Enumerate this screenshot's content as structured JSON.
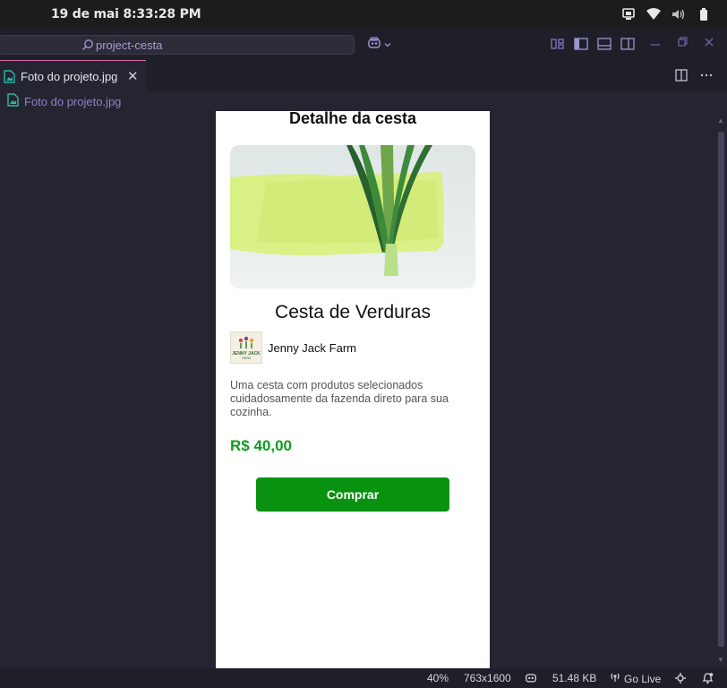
{
  "system_bar": {
    "clock": "19 de mai   8:33:28 PM",
    "icons": [
      "screen-share-icon",
      "wifi-icon",
      "volume-icon",
      "battery-icon"
    ]
  },
  "title_bar": {
    "search_text": "project-cesta",
    "icons": [
      "search-icon",
      "copilot-icon",
      "chevron-down-icon",
      "layout-customize-icon",
      "toggle-sidebar-icon",
      "toggle-panel-icon",
      "toggle-secondary-sidebar-icon",
      "minimize-icon",
      "restore-icon",
      "close-icon"
    ]
  },
  "editor": {
    "tab_label": "Foto do projeto.jpg",
    "breadcrumb": "Foto do projeto.jpg"
  },
  "phone": {
    "title": "Detalhe da cesta",
    "product_name": "Cesta de Verduras",
    "farm_name": "Jenny Jack Farm",
    "farm_logo_text": "JENNY JACK",
    "description": "Uma cesta com produtos selecionados cuidadosamente da fazenda direto para sua cozinha.",
    "price": "R$ 40,00",
    "buy_label": "Comprar"
  },
  "status_bar": {
    "zoom": "40%",
    "dimensions": "763x1600",
    "file_size": "51.48 KB",
    "go_live": "Go Live"
  },
  "colors": {
    "price": "#119c1e",
    "buy_button": "#08920f",
    "accent": "#8884c6"
  }
}
